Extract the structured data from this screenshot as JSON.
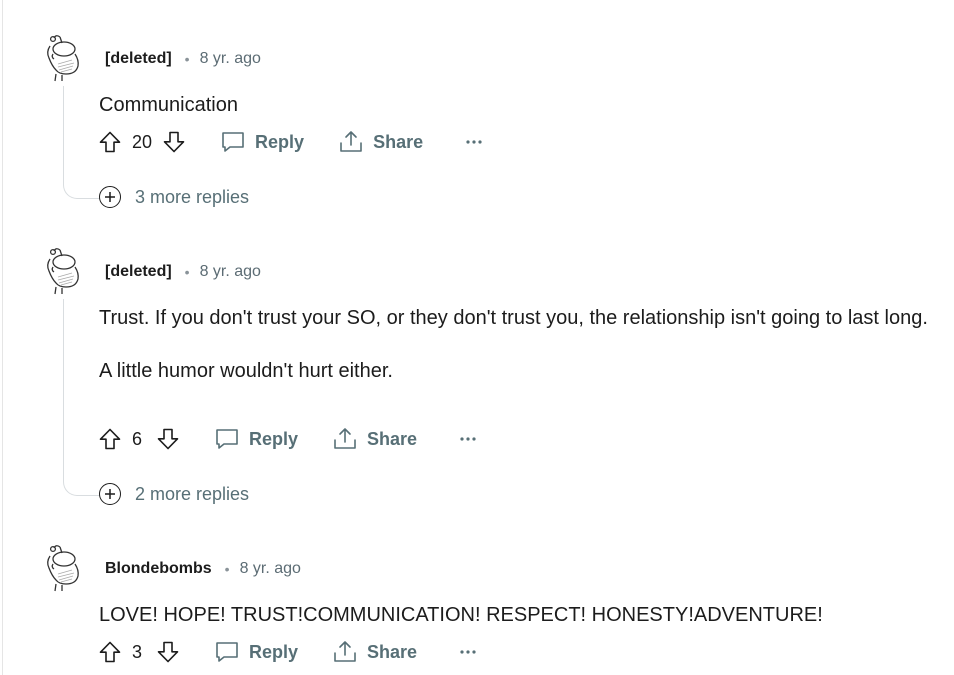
{
  "comments": [
    {
      "author": "[deleted]",
      "time": "8 yr. ago",
      "body": [
        "Communication"
      ],
      "score": "20",
      "reply_label": "Reply",
      "share_label": "Share",
      "more_replies": "3 more replies"
    },
    {
      "author": "[deleted]",
      "time": "8 yr. ago",
      "body": [
        "Trust. If you don't trust your SO, or they don't trust you, the relationship isn't going to last long.",
        "A little humor wouldn't hurt either."
      ],
      "score": "6",
      "reply_label": "Reply",
      "share_label": "Share",
      "more_replies": "2 more replies"
    },
    {
      "author": "Blondebombs",
      "time": "8 yr. ago",
      "body": [
        "LOVE! HOPE! TRUST!COMMUNICATION! RESPECT! HONESTY!ADVENTURE!"
      ],
      "score": "3",
      "reply_label": "Reply",
      "share_label": "Share"
    }
  ],
  "icons": {
    "avatar": "snoo-avatar-icon",
    "upvote": "upvote-arrow-icon",
    "downvote": "downvote-arrow-icon",
    "reply": "speech-bubble-icon",
    "share": "share-upload-icon",
    "more": "ellipsis-icon",
    "expand": "plus-circle-icon"
  },
  "colors": {
    "text": "#1c1c1c",
    "muted": "#576f76",
    "thread_line": "#d9dde0"
  }
}
